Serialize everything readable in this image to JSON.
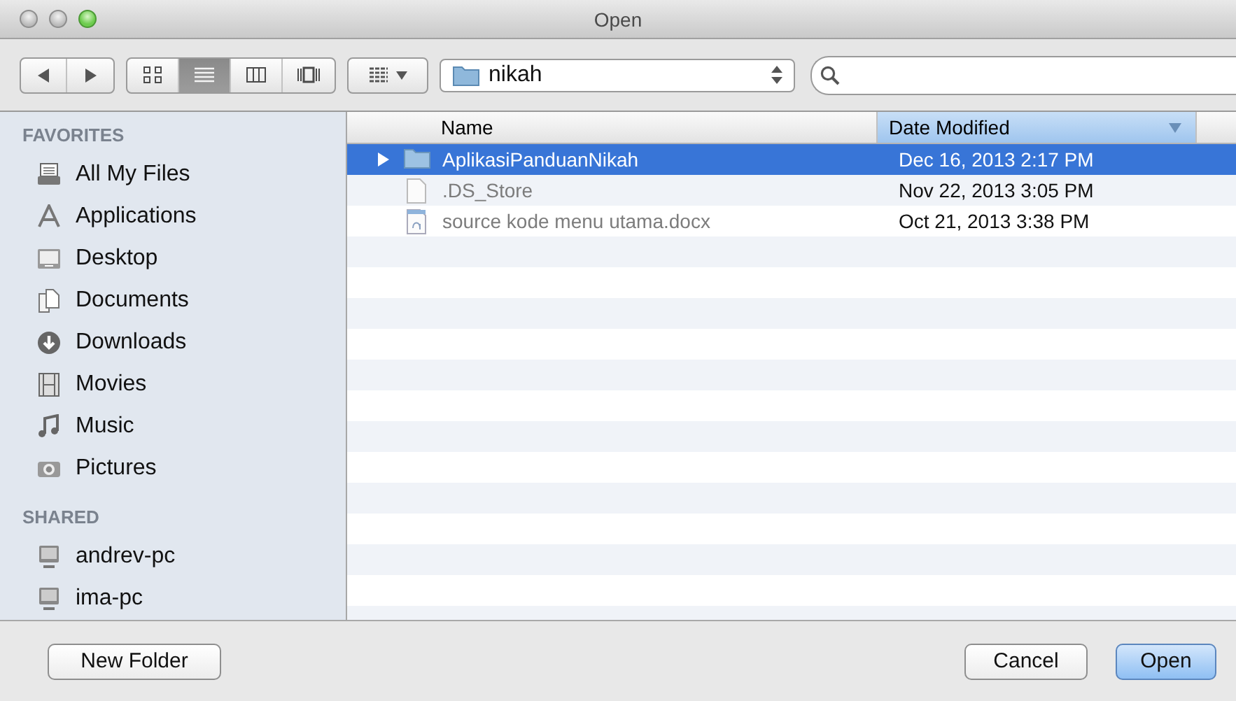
{
  "window": {
    "title": "Open",
    "controls": [
      {
        "kind": "close",
        "active": false
      },
      {
        "kind": "minimize",
        "active": false
      },
      {
        "kind": "zoom",
        "active": true
      }
    ]
  },
  "toolbar": {
    "nav": [
      {
        "kind": "back",
        "disabled": false
      },
      {
        "kind": "forward",
        "disabled": false
      }
    ],
    "view_modes": [
      {
        "kind": "icons",
        "selected": false
      },
      {
        "kind": "list",
        "selected": true
      },
      {
        "kind": "columns",
        "selected": false
      },
      {
        "kind": "coverflow",
        "selected": false
      }
    ],
    "location": "nikah"
  },
  "sidebar": {
    "sections": [
      {
        "heading": "FAVORITES",
        "items": [
          {
            "label": "All My Files",
            "kind": "all-files"
          },
          {
            "label": "Applications",
            "kind": "applications"
          },
          {
            "label": "Desktop",
            "kind": "desktop"
          },
          {
            "label": "Documents",
            "kind": "documents"
          },
          {
            "label": "Downloads",
            "kind": "downloads"
          },
          {
            "label": "Movies",
            "kind": "movies"
          },
          {
            "label": "Music",
            "kind": "music"
          },
          {
            "label": "Pictures",
            "kind": "pictures"
          }
        ]
      },
      {
        "heading": "SHARED",
        "items": [
          {
            "label": "andrev-pc",
            "kind": "computer"
          },
          {
            "label": "ima-pc",
            "kind": "computer"
          }
        ]
      }
    ]
  },
  "file_list": {
    "columns": [
      {
        "label": "Name",
        "selected": false
      },
      {
        "label": "Date Modified",
        "selected": true
      }
    ],
    "rows": [
      {
        "name": "AplikasiPanduanNikah",
        "kind": "folder",
        "date": "Dec 16, 2013 2:17 PM",
        "selected": true,
        "disabled": false,
        "expandable": true
      },
      {
        "name": ".DS_Store",
        "kind": "file",
        "date": "Nov 22, 2013 3:05 PM",
        "selected": false,
        "disabled": true,
        "expandable": false
      },
      {
        "name": "source kode menu utama.docx",
        "kind": "document",
        "date": "Oct 21, 2013 3:38 PM",
        "selected": false,
        "disabled": true,
        "expandable": false
      }
    ]
  },
  "buttons": [
    {
      "label": "New Folder",
      "kind": "normal"
    },
    {
      "label": "Cancel",
      "kind": "normal"
    },
    {
      "label": "Open",
      "kind": "default"
    }
  ]
}
